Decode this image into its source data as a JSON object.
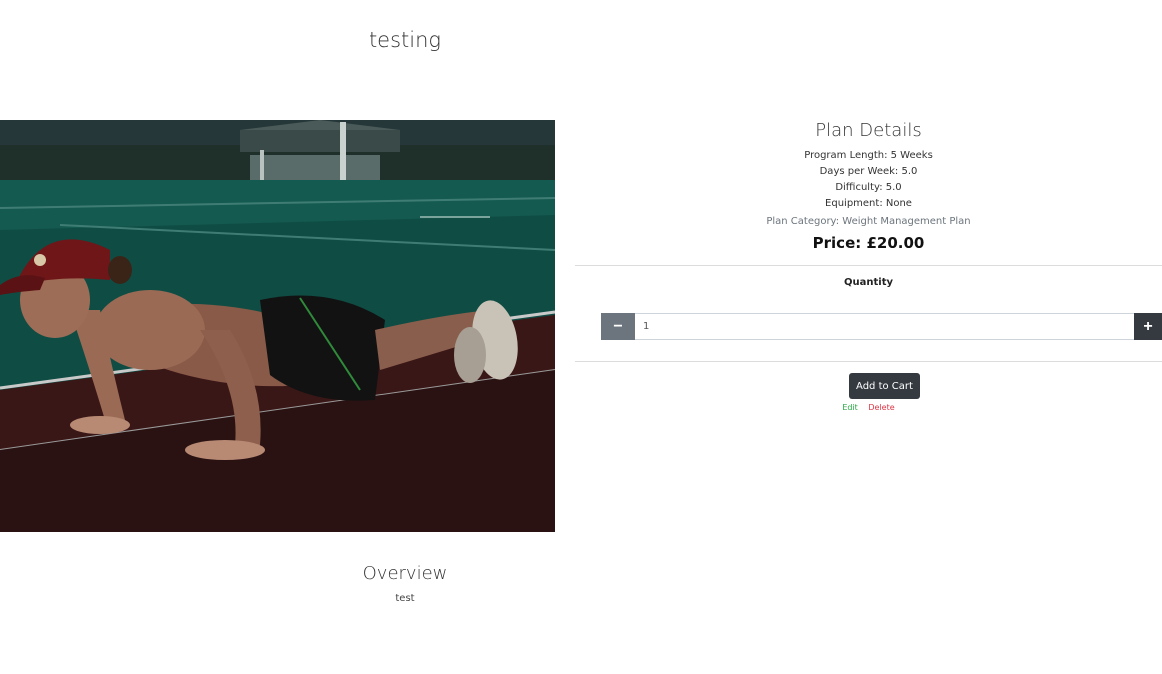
{
  "page": {
    "title": "testing"
  },
  "image": {
    "description_icon": "pushup-photo"
  },
  "overview": {
    "heading": "Overview",
    "text": "test"
  },
  "plan": {
    "heading": "Plan Details",
    "program_length": "Program Length: 5 Weeks",
    "days_per_week": "Days per Week: 5.0",
    "difficulty": "Difficulty: 5.0",
    "equipment": "Equipment: None",
    "category": "Plan Category: Weight Management Plan",
    "price": "Price: £20.00"
  },
  "quantity": {
    "label": "Quantity",
    "value": "1",
    "minus_symbol": "−",
    "plus_symbol": "+"
  },
  "actions": {
    "add_to_cart": "Add to Cart",
    "edit": "Edit",
    "delete": "Delete"
  },
  "colors": {
    "dark_button": "#343a40",
    "minus_button": "#6c757d",
    "edit_link": "#28a745",
    "delete_link": "#dc3545"
  }
}
